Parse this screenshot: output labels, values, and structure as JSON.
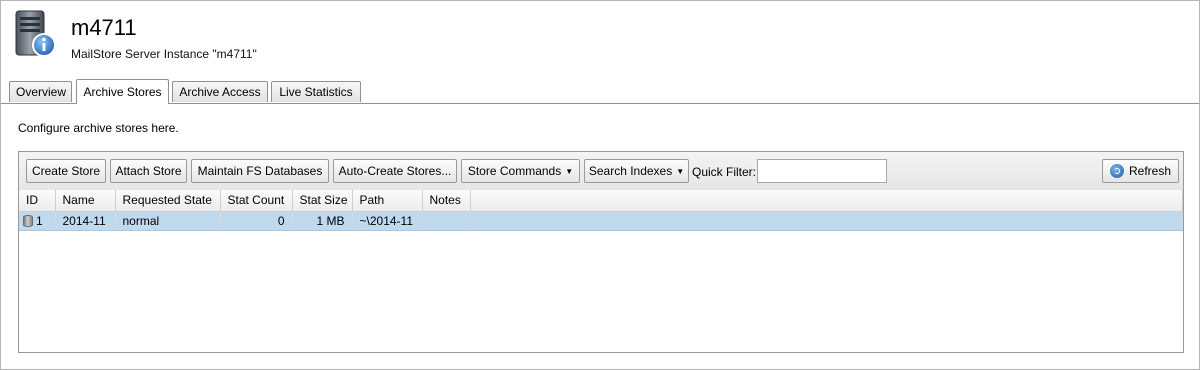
{
  "header": {
    "title": "m4711",
    "subtitle": "MailStore Server Instance \"m4711\"",
    "icon": "server-info-icon"
  },
  "tabs": [
    {
      "label": "Overview",
      "active": false
    },
    {
      "label": "Archive Stores",
      "active": true
    },
    {
      "label": "Archive Access",
      "active": false
    },
    {
      "label": "Live Statistics",
      "active": false
    }
  ],
  "description": "Configure archive stores here.",
  "toolbar": {
    "create_store": "Create Store",
    "attach_store": "Attach Store",
    "maintain_fs": "Maintain FS Databases",
    "auto_create": "Auto-Create Stores...",
    "store_commands": "Store Commands",
    "search_indexes": "Search Indexes",
    "quick_filter_label": "Quick Filter:",
    "quick_filter_value": "",
    "refresh": "Refresh"
  },
  "table": {
    "columns": [
      "ID",
      "Name",
      "Requested State",
      "Stat Count",
      "Stat Size",
      "Path",
      "Notes"
    ],
    "rows": [
      {
        "id": "1",
        "name": "2014-11",
        "requested_state": "normal",
        "stat_count": "0",
        "stat_size": "1 MB",
        "path": "~\\2014-11",
        "notes": "",
        "selected": true
      }
    ]
  },
  "colors": {
    "selection": "#bfd9ef",
    "border": "#999999"
  }
}
